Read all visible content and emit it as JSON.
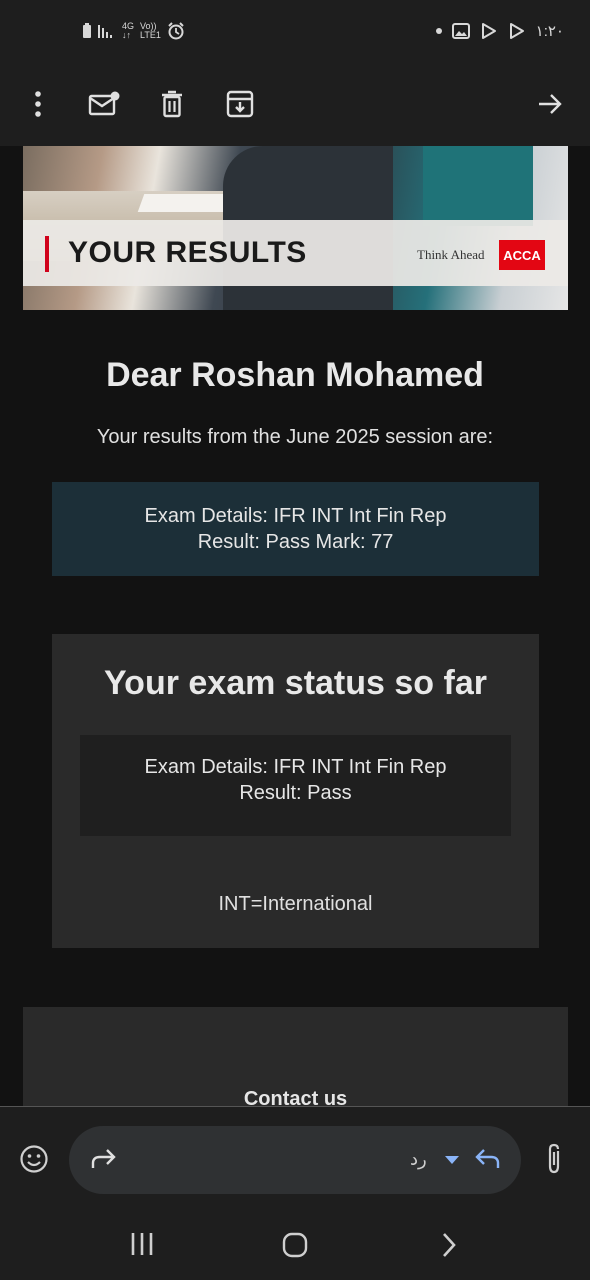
{
  "status_bar": {
    "network_4g": "4G",
    "arrows": "↓↑",
    "volte": "Vo))",
    "lte": "LTE1",
    "time": "١:٢٠",
    "icons": [
      "battery-icon",
      "signal-icon",
      "alarm-icon",
      "gallery-icon",
      "play-store-icon"
    ]
  },
  "toolbar": {
    "icons": [
      "more-vert-icon",
      "mark-unread-icon",
      "delete-icon",
      "archive-icon",
      "forward-arrow-icon"
    ]
  },
  "banner": {
    "title": "YOUR RESULTS",
    "tagline": "Think Ahead",
    "logo_text": "ACCA"
  },
  "email": {
    "greeting": "Dear Roshan Mohamed",
    "session_text": "Your results from the June 2025 session are:",
    "result_box": {
      "line1": "Exam Details: IFR INT Int Fin Rep",
      "line2": "Result: Pass Mark: 77"
    },
    "status_card": {
      "title": "Your exam status so far",
      "line1": "Exam Details: IFR INT Int Fin Rep",
      "line2": "Result: Pass",
      "note": "INT=International"
    },
    "contact_heading": "Contact us"
  },
  "reply_bar": {
    "reply_label": "رد",
    "icons": [
      "emoji-icon",
      "forward-icon",
      "dropdown-icon",
      "reply-icon",
      "attach-icon"
    ]
  },
  "nav_bar": {
    "icons": [
      "recents-icon",
      "home-icon",
      "back-icon"
    ]
  },
  "colors": {
    "accent_red": "#e30613",
    "result_box_bg": "#1c2f38",
    "card_bg": "#2a2a2a",
    "reply_blue": "#8ab4f8"
  }
}
